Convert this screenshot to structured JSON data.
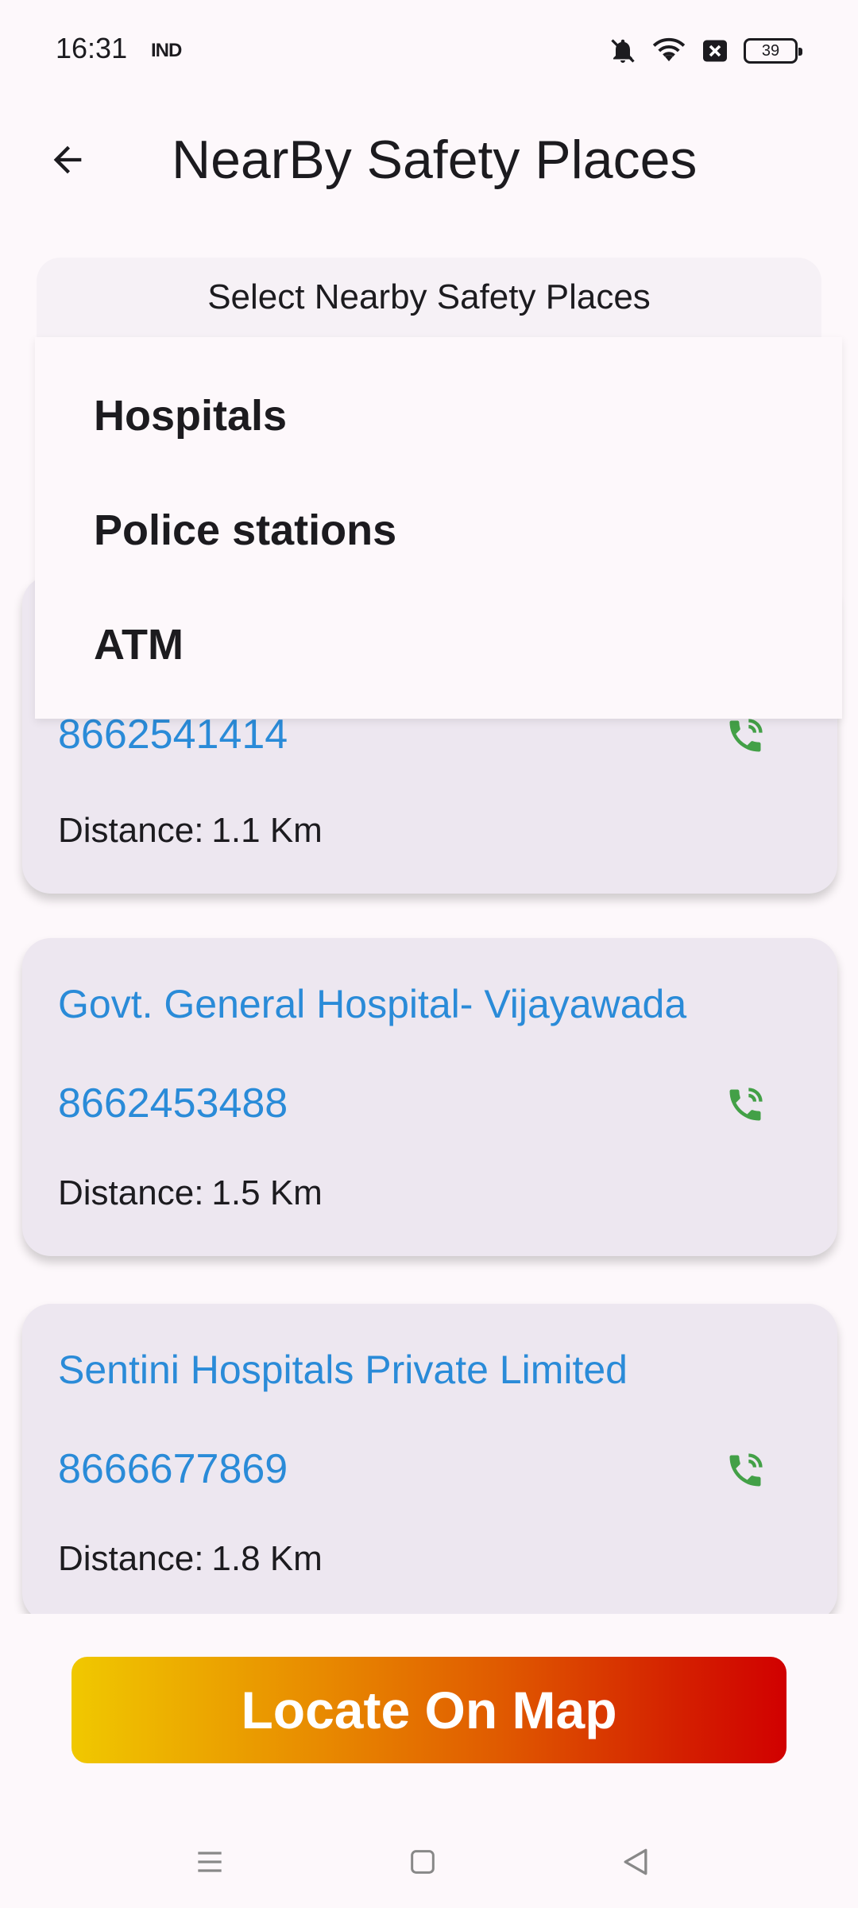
{
  "status_bar": {
    "time": "16:31",
    "carrier": "IND",
    "battery": "39"
  },
  "app_bar": {
    "title": "NearBy Safety Places"
  },
  "selector": {
    "label": "Select Nearby Safety Places",
    "options": [
      "Hospitals",
      "Police stations",
      "ATM"
    ]
  },
  "places": [
    {
      "name": "",
      "phone": "8662541414",
      "distance_label": "Distance:",
      "distance": "1.1 Km"
    },
    {
      "name": "Govt. General Hospital- Vijayawada",
      "phone": "8662453488",
      "distance_label": "Distance:",
      "distance": "1.5 Km"
    },
    {
      "name": "Sentini Hospitals Private Limited",
      "phone": "8666677869",
      "distance_label": "Distance:",
      "distance": "1.8 Km"
    }
  ],
  "actions": {
    "locate_label": "Locate On Map"
  },
  "colors": {
    "link": "#2a8bd8",
    "call_icon": "#43a047",
    "card_bg": "#ede7f0"
  },
  "icons": {
    "back": "arrow-left-icon",
    "call": "phone-call-icon",
    "bell_off": "bell-off-icon",
    "wifi": "wifi-icon",
    "nav_menu": "menu-icon",
    "nav_home": "square-icon",
    "nav_back": "triangle-back-icon"
  }
}
